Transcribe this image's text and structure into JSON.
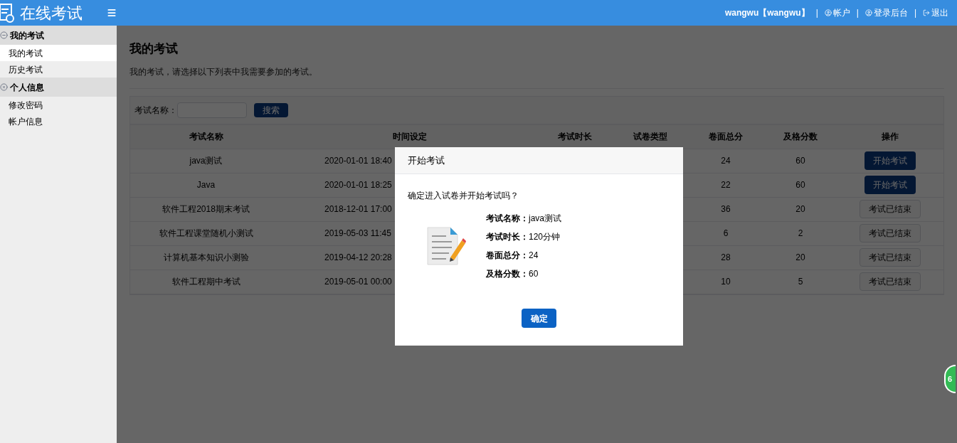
{
  "header": {
    "title": "在线考试",
    "items": [
      {
        "kind": "user",
        "label": "wangwu【wangwu】",
        "separator": "|"
      },
      {
        "kind": "account",
        "label": "帐户",
        "separator": "|"
      },
      {
        "kind": "admin",
        "label": "登录后台",
        "separator": "|"
      },
      {
        "kind": "logout",
        "label": "退出"
      }
    ]
  },
  "sidebar": {
    "groups": [
      {
        "kind": "minus",
        "label": "我的考试",
        "children": [
          {
            "label": "我的考试",
            "selected": true
          },
          {
            "label": "历史考试",
            "selected": false
          }
        ]
      },
      {
        "kind": "cross",
        "label": "个人信息",
        "children": [
          {
            "label": "修改密码",
            "selected": false
          },
          {
            "label": "帐户信息",
            "selected": false
          }
        ]
      }
    ]
  },
  "page": {
    "title": "我的考试",
    "subtitle": "我的考试，请选择以下列表中我需要参加的考试。",
    "search": {
      "label": "考试名称：",
      "button": "搜索"
    },
    "table": {
      "columns": [
        "考试名称",
        "时间设定",
        "考试时长",
        "试卷类型",
        "卷面总分",
        "及格分数",
        "操作"
      ],
      "rows": [
        {
          "name": "java测试",
          "time": "2020-01-01 18:40",
          "total": "24",
          "pass": "60",
          "action": {
            "kind": "start",
            "label": "开始考试"
          }
        },
        {
          "name": "Java",
          "time": "2020-01-01 18:25",
          "total": "22",
          "pass": "60",
          "action": {
            "kind": "start",
            "label": "开始考试"
          }
        },
        {
          "name": "软件工程2018期末考试",
          "time": "2018-12-01 17:00",
          "total": "36",
          "pass": "20",
          "action": {
            "kind": "ended",
            "label": "考试已结束"
          }
        },
        {
          "name": "软件工程课堂随机小测试",
          "time": "2019-05-03 11:45",
          "total": "6",
          "pass": "2",
          "action": {
            "kind": "ended",
            "label": "考试已结束"
          }
        },
        {
          "name": "计算机基本知识小测验",
          "time": "2019-04-12 20:28",
          "total": "28",
          "pass": "20",
          "action": {
            "kind": "ended",
            "label": "考试已结束"
          }
        },
        {
          "name": "软件工程期中考试",
          "time": "2019-05-01 00:00",
          "total": "10",
          "pass": "5",
          "action": {
            "kind": "ended",
            "label": "考试已结束"
          }
        }
      ]
    }
  },
  "modal": {
    "title": "开始考试",
    "question": "确定进入试卷并开始考试吗？",
    "fields": [
      {
        "label": "考试名称：",
        "value": "java测试"
      },
      {
        "label": "考试时长：",
        "value": "120分钟"
      },
      {
        "label": "卷面总分：",
        "value": "24"
      },
      {
        "label": "及格分数：",
        "value": "60"
      }
    ],
    "confirm": "确定"
  },
  "badge": "6"
}
